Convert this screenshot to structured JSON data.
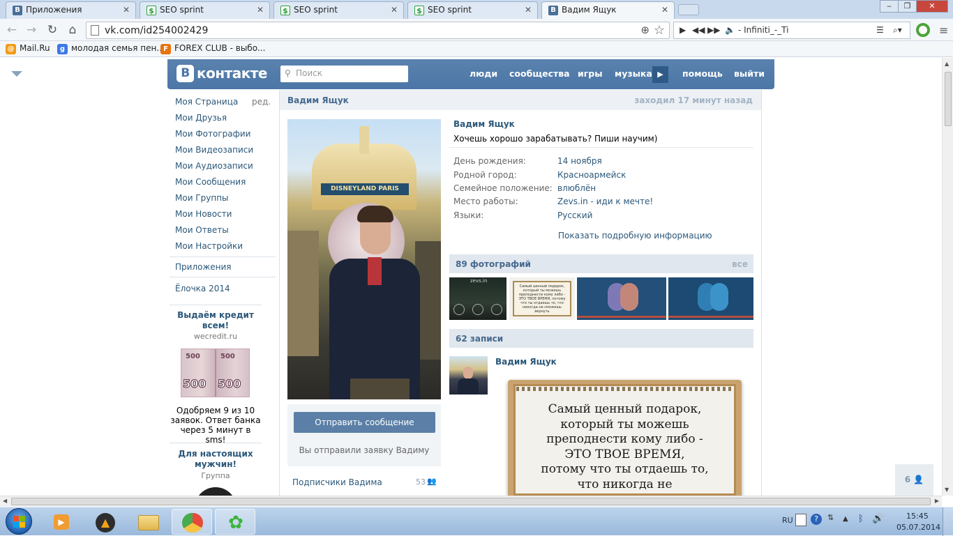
{
  "browser": {
    "tabs": [
      {
        "title": "Приложения",
        "icon": "vk-icon"
      },
      {
        "title": "SEO sprint",
        "icon": "seosprint-icon"
      },
      {
        "title": "SEO sprint",
        "icon": "seosprint-icon"
      },
      {
        "title": "SEO sprint",
        "icon": "seosprint-icon"
      },
      {
        "title": "Вадим Ящук",
        "icon": "vk-icon"
      }
    ],
    "url": "vk.com/id254002429",
    "player_track": "- Infiniti_-_Ti",
    "bookmarks": [
      "Mail.Ru",
      "молодая семья пен...",
      "FOREX CLUB - выбо..."
    ]
  },
  "vk": {
    "logo_text": "контакте",
    "logo_letter": "В",
    "search_placeholder": "Поиск",
    "nav": [
      "люди",
      "сообщества",
      "игры",
      "музыка",
      "помощь",
      "выйти"
    ],
    "left_menu": [
      "Моя Страница",
      "Мои Друзья",
      "Мои Фотографии",
      "Мои Видеозаписи",
      "Мои Аудиозаписи",
      "Мои Сообщения",
      "Мои Группы",
      "Мои Новости",
      "Мои Ответы",
      "Мои Настройки"
    ],
    "edit_label": "ред.",
    "apps_label": "Приложения",
    "app_item": "Ёлочка 2014",
    "ad1": {
      "title": "Выдаём кредит всем!",
      "site": "wecredit.ru",
      "text": "Одобряем 9 из 10 заявок. Ответ банка через 5 минут в sms!",
      "banknote": "500"
    },
    "ad2": {
      "title": "Для настоящих мужчин!",
      "sub": "Группа"
    }
  },
  "profile": {
    "name": "Вадим Ящук",
    "last_seen": "заходил 17 минут назад",
    "status": "Хочешь хорошо зарабатывать? Пиши научим)",
    "photo_sign": "DISNEYLAND PARIS",
    "info": [
      {
        "label": "День рождения:",
        "value": "14 ноября"
      },
      {
        "label": "Родной город:",
        "value": "Красноармейск"
      },
      {
        "label": "Семейное положение:",
        "value": "влюблён"
      },
      {
        "label": "Место работы:",
        "value": "Zevs.in - иди к мечте!"
      },
      {
        "label": "Языки:",
        "value": "Русский"
      }
    ],
    "more_info": "Показать подробную информацию",
    "photos_title": "89 фотографий",
    "photos_all": "все",
    "posts_title": "62 записи",
    "send_message": "Отправить сообщение",
    "request_sent": "Вы отправили заявку Вадиму",
    "subscribers_label": "Подписчики Вадима",
    "subscribers_count": "53",
    "post_author": "Вадим Ящук",
    "post_text": [
      "Самый ценный подарок,",
      "который ты можешь",
      "преподнести кому либо -",
      "ЭТО ТВОЕ ВРЕМЯ,",
      "потому что ты отдаешь то,",
      "что никогда не"
    ],
    "thumb2_text": "Самый ценный подарок, который ты можешь преподнести кому либо - ЭТО ТВОЕ ВРЕМЯ, потому что ты отдаешь то, что никогда не сможешь вернуть",
    "thumb1_text": "zevs.in",
    "side_counter": "6"
  },
  "taskbar": {
    "lang": "RU",
    "time": "15:45",
    "date": "05.07.2014"
  }
}
